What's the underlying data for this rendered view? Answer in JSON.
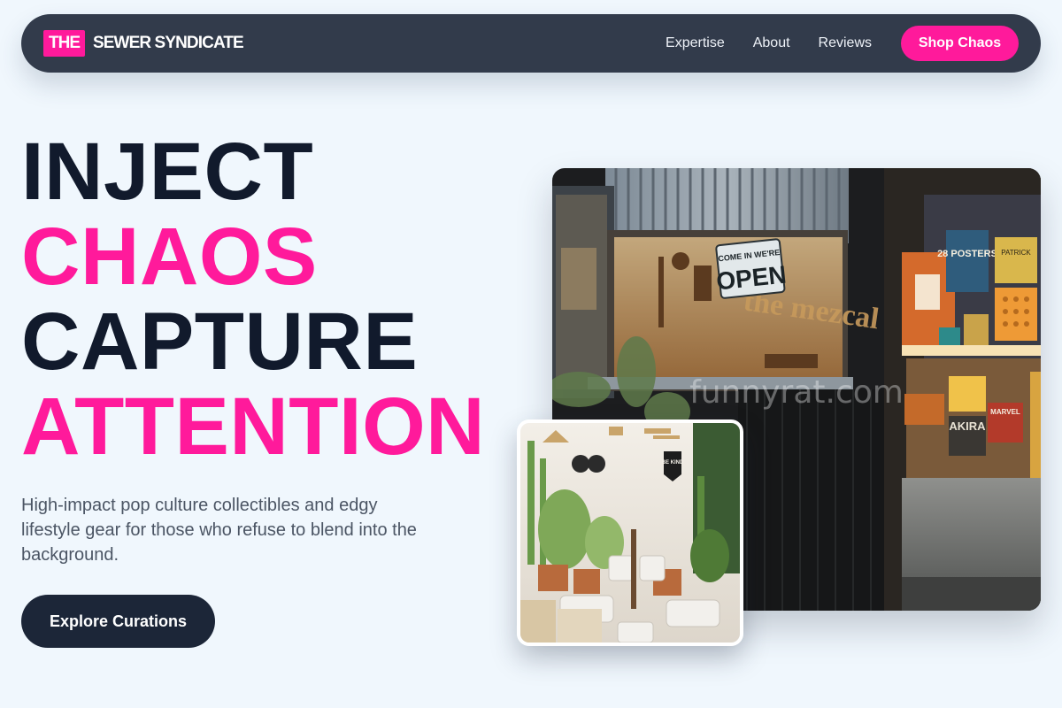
{
  "nav": {
    "logo_highlight": "THE",
    "logo_text": "SEWER SYNDICATE",
    "links": [
      "Expertise",
      "About",
      "Reviews"
    ],
    "cta": "Shop Chaos"
  },
  "hero": {
    "line1": "INJECT",
    "line2": "CHAOS",
    "line3": "CAPTURE",
    "line4": "ATTENTION",
    "subtitle": "High-impact pop culture collectibles and edgy lifestyle gear for those who refuse to blend into the background.",
    "button": "Explore Curations"
  },
  "main_photo": {
    "sign_top": "COME IN WE'RE",
    "sign_main": "OPEN",
    "shop_sign": "the mezcal",
    "poster_text": "28 POSTERS",
    "poster_small": "PATRICK",
    "poster_akira": "AKIRA",
    "poster_marvel": "MARVEL",
    "watermark": "funnyrat.com"
  },
  "inset_photo": {
    "sign": "BE KIND"
  },
  "colors": {
    "accent": "#ff1a9b",
    "nav_bg": "#323b4b",
    "page_bg": "#f0f7fd",
    "dark_text": "#111a2c",
    "button_bg": "#1c2638"
  }
}
